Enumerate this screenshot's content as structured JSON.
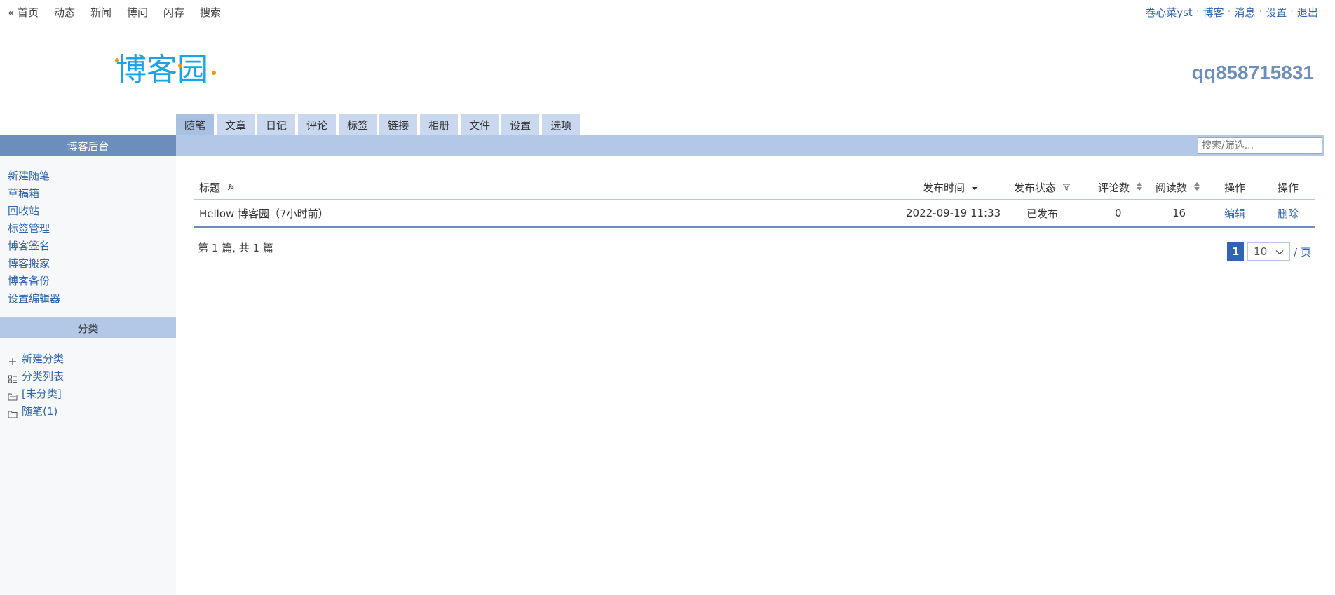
{
  "topnav": {
    "items": [
      "« 首页",
      "动态",
      "新闻",
      "博问",
      "闪存",
      "搜索"
    ]
  },
  "usernav": {
    "user": "卷心菜yst",
    "blog": "博客",
    "messages": "消息",
    "settings": "设置",
    "logout": "退出",
    "separator": "·"
  },
  "header": {
    "logo_text": "博客园",
    "blog_name": "qq858715831"
  },
  "tabs": [
    "随笔",
    "文章",
    "日记",
    "评论",
    "标签",
    "链接",
    "相册",
    "文件",
    "设置",
    "选项"
  ],
  "active_tab": "随笔",
  "search": {
    "placeholder": "搜索/筛选..."
  },
  "sidebar": {
    "title": "博客后台",
    "links": [
      "新建随笔",
      "草稿箱",
      "回收站",
      "标签管理",
      "博客签名",
      "博客搬家",
      "博客备份",
      "设置编辑器"
    ],
    "category_title": "分类",
    "categories": [
      {
        "label": "新建分类",
        "icon": "plus-icon"
      },
      {
        "label": "分类列表",
        "icon": "list-icon"
      },
      {
        "label": "[未分类]",
        "icon": "folder-open-icon"
      },
      {
        "label": "随笔(1)",
        "icon": "folder-icon"
      }
    ]
  },
  "table": {
    "headers": {
      "title": "标题",
      "date": "发布时间",
      "status": "发布状态",
      "comments": "评论数",
      "views": "阅读数",
      "op1": "操作",
      "op2": "操作"
    },
    "rows": [
      {
        "title": "Hellow 博客园（7小时前）",
        "date": "2022-09-19 11:33",
        "status": "已发布",
        "comments": "0",
        "views": "16",
        "edit": "编辑",
        "delete": "删除"
      }
    ]
  },
  "footer": {
    "summary": "第 1 篇, 共 1 篇",
    "current_page": "1",
    "page_size": "10",
    "page_unit": "/ 页"
  },
  "colors": {
    "accent": "#6b8ebd",
    "band": "#b3c8e7",
    "link": "#2d64b3",
    "logo": "#1aa3e8"
  }
}
